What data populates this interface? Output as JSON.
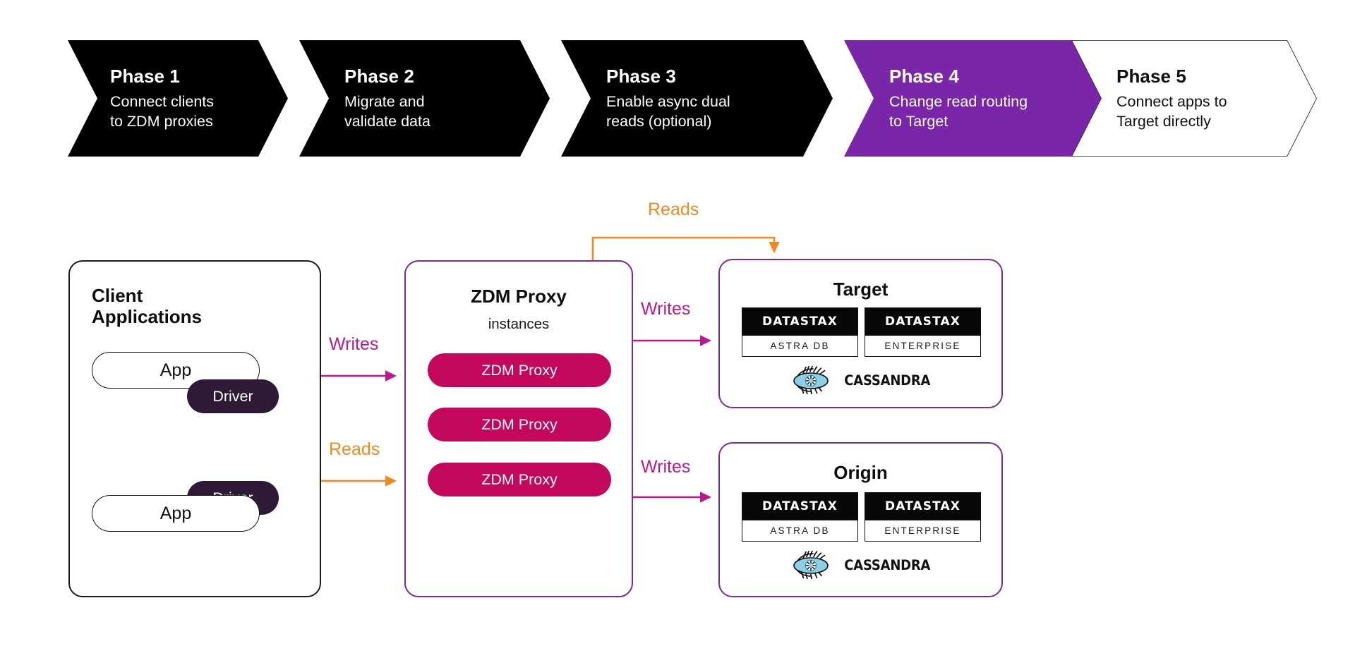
{
  "phases": {
    "items": [
      {
        "title": "Phase 1",
        "desc": "Connect clients\nto ZDM proxies",
        "style": "filled-black"
      },
      {
        "title": "Phase 2",
        "desc": "Migrate and\nvalidate data",
        "style": "filled-black"
      },
      {
        "title": "Phase 3",
        "desc": "Enable async dual\nreads (optional)",
        "style": "filled-black"
      },
      {
        "title": "Phase 4",
        "desc": "Change read routing\nto Target",
        "style": "filled-purple"
      },
      {
        "title": "Phase 5",
        "desc": "Connect apps to\nTarget directly",
        "style": "outline"
      }
    ]
  },
  "colors": {
    "black": "#000000",
    "purple_active": "#7A26A8",
    "panel_border_purple": "#7B2A96",
    "magenta_writes": "#BC1A8C",
    "orange_reads": "#F08A20",
    "proxy_pill": "#C2075C",
    "driver_pill": "#2E1A36",
    "cassandra_eye_blue": "#8ECFE8"
  },
  "diagram": {
    "client_panel": {
      "title": "Client\nApplications",
      "apps": [
        {
          "app_label": "App",
          "driver_label": "Driver"
        },
        {
          "app_label": "App",
          "driver_label": "Driver"
        }
      ]
    },
    "proxy_panel": {
      "title": "ZDM Proxy",
      "subtitle": "instances",
      "instances": [
        {
          "label": "ZDM Proxy"
        },
        {
          "label": "ZDM Proxy"
        },
        {
          "label": "ZDM Proxy"
        }
      ]
    },
    "target_panel": {
      "title": "Target",
      "products": [
        {
          "brand": "DATASTAX",
          "name": "ASTRA DB"
        },
        {
          "brand": "DATASTAX",
          "name": "ENTERPRISE"
        }
      ],
      "cassandra_label": "CASSANDRA"
    },
    "origin_panel": {
      "title": "Origin",
      "products": [
        {
          "brand": "DATASTAX",
          "name": "ASTRA DB"
        },
        {
          "brand": "DATASTAX",
          "name": "ENTERPRISE"
        }
      ],
      "cassandra_label": "CASSANDRA"
    },
    "arrows": {
      "client_to_proxy_writes": "Writes",
      "client_to_proxy_reads": "Reads",
      "proxy_to_target_writes": "Writes",
      "proxy_to_origin_writes": "Writes",
      "proxy_to_target_reads": "Reads"
    }
  }
}
